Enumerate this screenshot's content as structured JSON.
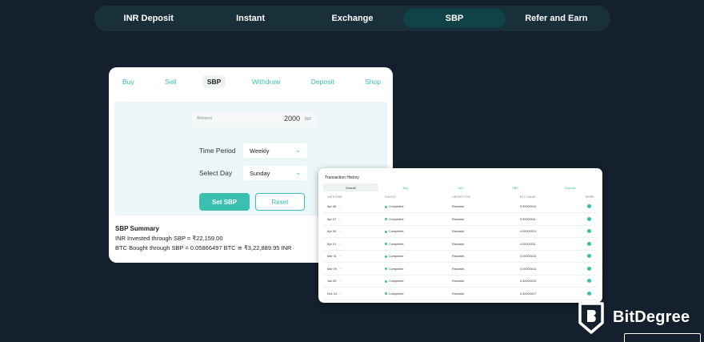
{
  "top_nav": {
    "tabs": [
      {
        "label": "INR Deposit"
      },
      {
        "label": "Instant"
      },
      {
        "label": "Exchange"
      },
      {
        "label": "SBP",
        "active": true
      },
      {
        "label": "Refer and Earn"
      }
    ]
  },
  "sbp_card": {
    "tabs": [
      "Buy",
      "Sell",
      "SBP",
      "Withdraw",
      "Deposit",
      "Shop"
    ],
    "active_tab": "SBP",
    "amount": {
      "label": "Amount",
      "value": "2000",
      "unit": "INR"
    },
    "time_period": {
      "label": "Time Period",
      "value": "Weekly"
    },
    "select_day": {
      "label": "Select Day",
      "value": "Sunday"
    },
    "set_button": "Set SBP",
    "reset_button": "Reset",
    "summary": {
      "heading": "SBP Summary",
      "invested": "INR Invested through SBP = ₹22,159.00",
      "bought": "BTC Bought through SBP = 0.05866497 BTC ≅ ₹3,22,889.95 INR"
    }
  },
  "tx_card": {
    "title": "Transaction History",
    "filter_tabs": [
      "Overall",
      "Buy",
      "Sell",
      "SBP",
      "Deposit"
    ],
    "active_filter": "Overall",
    "columns": [
      "DATE/TIME",
      "STATUS",
      "ORDER TYPE",
      "BTC VALUE",
      "MORE"
    ],
    "rows": [
      {
        "date": "Apr 08",
        "status": "Completed",
        "type": "Rewards",
        "value": "0.00000010"
      },
      {
        "date": "Apr 07",
        "status": "Completed",
        "type": "Rewards",
        "value": "0.00000011"
      },
      {
        "date": "Apr 06",
        "status": "Completed",
        "type": "Rewards",
        "value": "0.00000013"
      },
      {
        "date": "Apr 01",
        "status": "Completed",
        "type": "Rewards",
        "value": "0.00000011"
      },
      {
        "date": "Mar 31",
        "status": "Completed",
        "type": "Rewards",
        "value": "0.00000015"
      },
      {
        "date": "Mar 09",
        "status": "Completed",
        "type": "Rewards",
        "value": "0.00000014"
      },
      {
        "date": "Jan 05",
        "status": "Completed",
        "type": "Rewards",
        "value": "0.00000015"
      },
      {
        "date": "Dec 04",
        "status": "Completed",
        "type": "Rewards",
        "value": "0.00000017"
      }
    ]
  },
  "brand": {
    "name": "BitDegree",
    "logo_icon": "bitdegree-shield-icon"
  },
  "colors": {
    "accent": "#3bbfb0",
    "background": "#15202e",
    "nav_bg": "#19303a",
    "nav_active": "#0f4346"
  }
}
